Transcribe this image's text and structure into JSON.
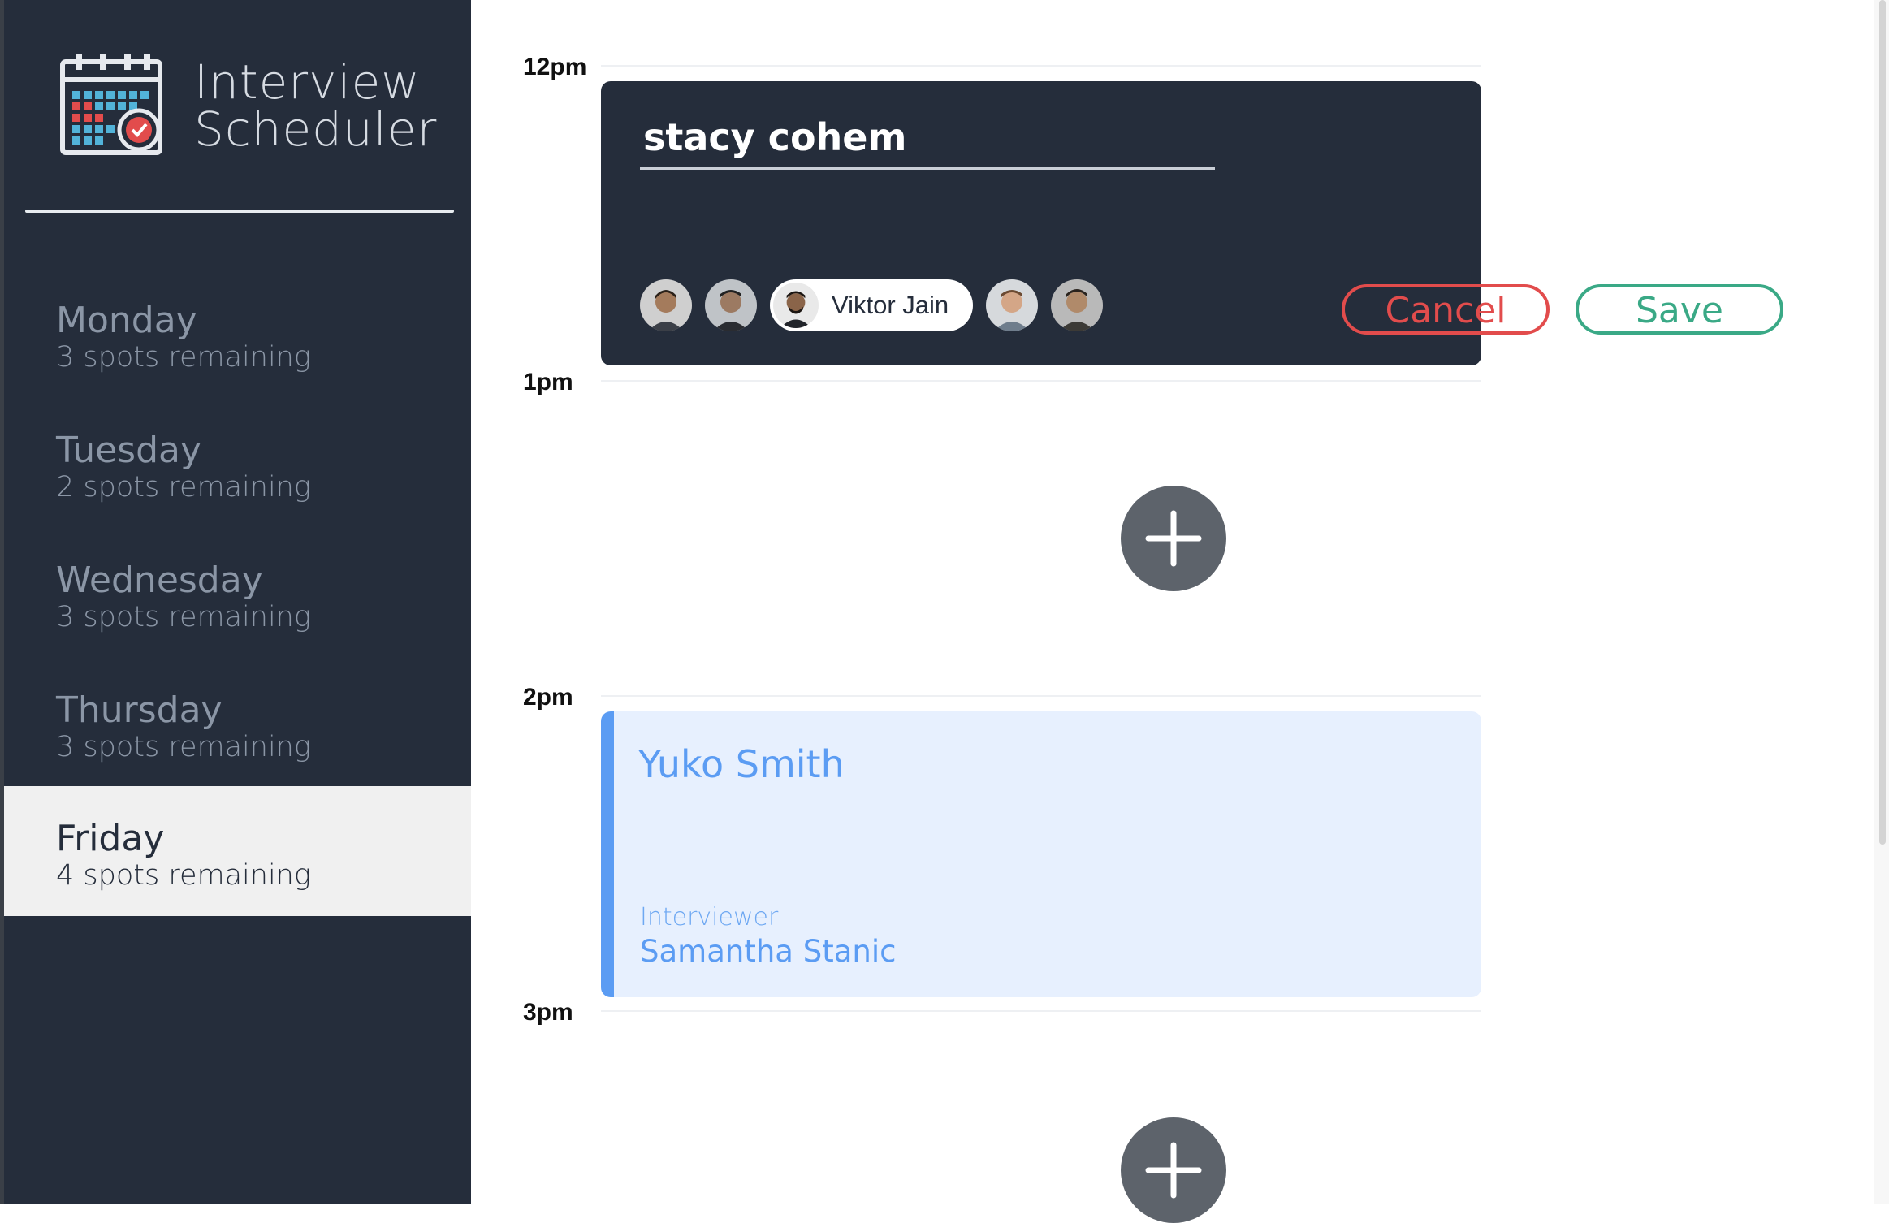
{
  "app": {
    "title_line1": "Interview",
    "title_line2": "Scheduler"
  },
  "sidebar": {
    "days": [
      {
        "name": "Monday",
        "spots": "3 spots remaining"
      },
      {
        "name": "Tuesday",
        "spots": "2 spots remaining"
      },
      {
        "name": "Wednesday",
        "spots": "3 spots remaining"
      },
      {
        "name": "Thursday",
        "spots": "3 spots remaining"
      },
      {
        "name": "Friday",
        "spots": "4 spots remaining",
        "selected": true
      }
    ]
  },
  "schedule": {
    "hours": [
      "12pm",
      "1pm",
      "2pm",
      "3pm"
    ],
    "form": {
      "student_name": "stacy cohem",
      "selected_interviewer": "Viktor Jain",
      "cancel_label": "Cancel",
      "save_label": "Save"
    },
    "appointment": {
      "student": "Yuko Smith",
      "interviewer_label": "Interviewer",
      "interviewer": "Samantha Stanic"
    }
  },
  "colors": {
    "sidebar_bg": "#252d3b",
    "selected_day_bg": "#f0f0f0",
    "cancel": "#e24c4c",
    "save": "#3aa986",
    "appointment_accent": "#5b9cf3",
    "appointment_bg": "#e7f0fe"
  },
  "icons": {
    "logo": "calendar-check-icon",
    "add": "plus-icon"
  }
}
